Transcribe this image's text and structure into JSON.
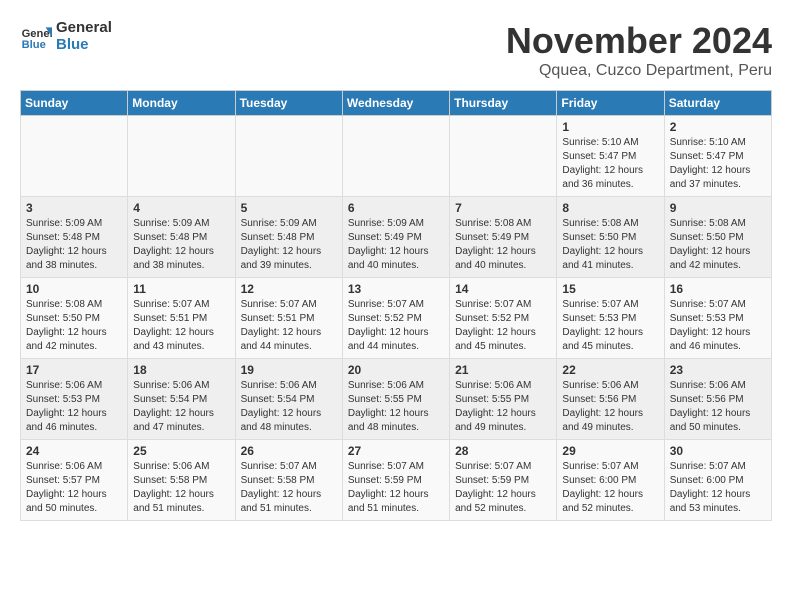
{
  "header": {
    "logo_general": "General",
    "logo_blue": "Blue",
    "month_title": "November 2024",
    "location": "Qquea, Cuzco Department, Peru"
  },
  "days_of_week": [
    "Sunday",
    "Monday",
    "Tuesday",
    "Wednesday",
    "Thursday",
    "Friday",
    "Saturday"
  ],
  "weeks": [
    {
      "days": [
        {
          "num": "",
          "detail": ""
        },
        {
          "num": "",
          "detail": ""
        },
        {
          "num": "",
          "detail": ""
        },
        {
          "num": "",
          "detail": ""
        },
        {
          "num": "",
          "detail": ""
        },
        {
          "num": "1",
          "detail": "Sunrise: 5:10 AM\nSunset: 5:47 PM\nDaylight: 12 hours\nand 36 minutes."
        },
        {
          "num": "2",
          "detail": "Sunrise: 5:10 AM\nSunset: 5:47 PM\nDaylight: 12 hours\nand 37 minutes."
        }
      ]
    },
    {
      "days": [
        {
          "num": "3",
          "detail": "Sunrise: 5:09 AM\nSunset: 5:48 PM\nDaylight: 12 hours\nand 38 minutes."
        },
        {
          "num": "4",
          "detail": "Sunrise: 5:09 AM\nSunset: 5:48 PM\nDaylight: 12 hours\nand 38 minutes."
        },
        {
          "num": "5",
          "detail": "Sunrise: 5:09 AM\nSunset: 5:48 PM\nDaylight: 12 hours\nand 39 minutes."
        },
        {
          "num": "6",
          "detail": "Sunrise: 5:09 AM\nSunset: 5:49 PM\nDaylight: 12 hours\nand 40 minutes."
        },
        {
          "num": "7",
          "detail": "Sunrise: 5:08 AM\nSunset: 5:49 PM\nDaylight: 12 hours\nand 40 minutes."
        },
        {
          "num": "8",
          "detail": "Sunrise: 5:08 AM\nSunset: 5:50 PM\nDaylight: 12 hours\nand 41 minutes."
        },
        {
          "num": "9",
          "detail": "Sunrise: 5:08 AM\nSunset: 5:50 PM\nDaylight: 12 hours\nand 42 minutes."
        }
      ]
    },
    {
      "days": [
        {
          "num": "10",
          "detail": "Sunrise: 5:08 AM\nSunset: 5:50 PM\nDaylight: 12 hours\nand 42 minutes."
        },
        {
          "num": "11",
          "detail": "Sunrise: 5:07 AM\nSunset: 5:51 PM\nDaylight: 12 hours\nand 43 minutes."
        },
        {
          "num": "12",
          "detail": "Sunrise: 5:07 AM\nSunset: 5:51 PM\nDaylight: 12 hours\nand 44 minutes."
        },
        {
          "num": "13",
          "detail": "Sunrise: 5:07 AM\nSunset: 5:52 PM\nDaylight: 12 hours\nand 44 minutes."
        },
        {
          "num": "14",
          "detail": "Sunrise: 5:07 AM\nSunset: 5:52 PM\nDaylight: 12 hours\nand 45 minutes."
        },
        {
          "num": "15",
          "detail": "Sunrise: 5:07 AM\nSunset: 5:53 PM\nDaylight: 12 hours\nand 45 minutes."
        },
        {
          "num": "16",
          "detail": "Sunrise: 5:07 AM\nSunset: 5:53 PM\nDaylight: 12 hours\nand 46 minutes."
        }
      ]
    },
    {
      "days": [
        {
          "num": "17",
          "detail": "Sunrise: 5:06 AM\nSunset: 5:53 PM\nDaylight: 12 hours\nand 46 minutes."
        },
        {
          "num": "18",
          "detail": "Sunrise: 5:06 AM\nSunset: 5:54 PM\nDaylight: 12 hours\nand 47 minutes."
        },
        {
          "num": "19",
          "detail": "Sunrise: 5:06 AM\nSunset: 5:54 PM\nDaylight: 12 hours\nand 48 minutes."
        },
        {
          "num": "20",
          "detail": "Sunrise: 5:06 AM\nSunset: 5:55 PM\nDaylight: 12 hours\nand 48 minutes."
        },
        {
          "num": "21",
          "detail": "Sunrise: 5:06 AM\nSunset: 5:55 PM\nDaylight: 12 hours\nand 49 minutes."
        },
        {
          "num": "22",
          "detail": "Sunrise: 5:06 AM\nSunset: 5:56 PM\nDaylight: 12 hours\nand 49 minutes."
        },
        {
          "num": "23",
          "detail": "Sunrise: 5:06 AM\nSunset: 5:56 PM\nDaylight: 12 hours\nand 50 minutes."
        }
      ]
    },
    {
      "days": [
        {
          "num": "24",
          "detail": "Sunrise: 5:06 AM\nSunset: 5:57 PM\nDaylight: 12 hours\nand 50 minutes."
        },
        {
          "num": "25",
          "detail": "Sunrise: 5:06 AM\nSunset: 5:58 PM\nDaylight: 12 hours\nand 51 minutes."
        },
        {
          "num": "26",
          "detail": "Sunrise: 5:07 AM\nSunset: 5:58 PM\nDaylight: 12 hours\nand 51 minutes."
        },
        {
          "num": "27",
          "detail": "Sunrise: 5:07 AM\nSunset: 5:59 PM\nDaylight: 12 hours\nand 51 minutes."
        },
        {
          "num": "28",
          "detail": "Sunrise: 5:07 AM\nSunset: 5:59 PM\nDaylight: 12 hours\nand 52 minutes."
        },
        {
          "num": "29",
          "detail": "Sunrise: 5:07 AM\nSunset: 6:00 PM\nDaylight: 12 hours\nand 52 minutes."
        },
        {
          "num": "30",
          "detail": "Sunrise: 5:07 AM\nSunset: 6:00 PM\nDaylight: 12 hours\nand 53 minutes."
        }
      ]
    }
  ]
}
